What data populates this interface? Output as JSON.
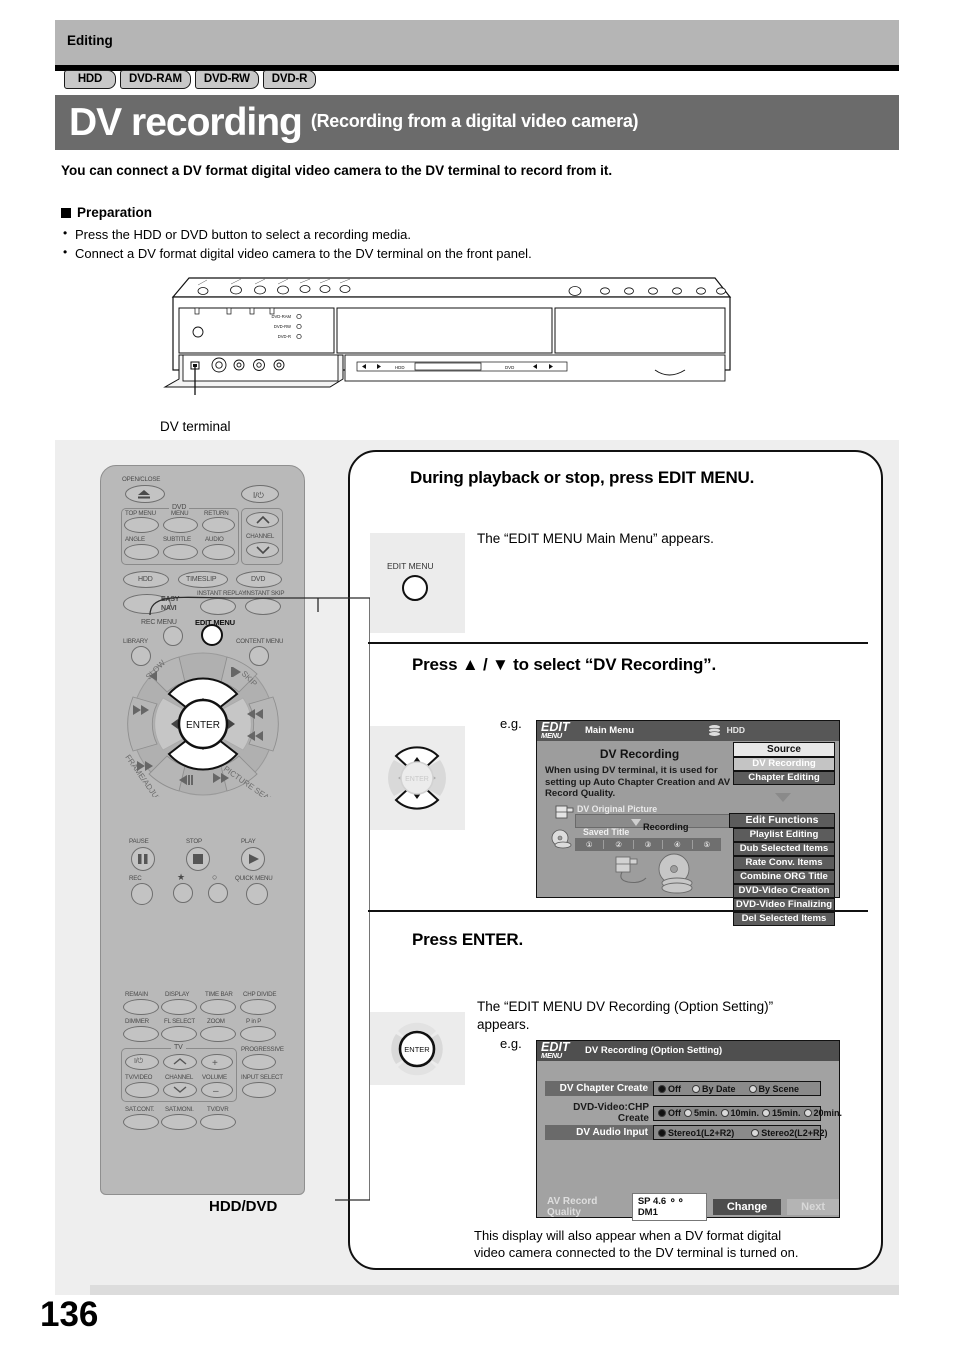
{
  "header": {
    "section_label": "Editing",
    "badges": [
      "HDD",
      "DVD-RAM",
      "DVD-RW",
      "DVD-R"
    ],
    "title_main": "DV recording",
    "title_sub": "(Recording from a digital video camera)"
  },
  "intro": {
    "lead": "You can connect a DV format digital video camera to the DV terminal to record from it.",
    "prep_heading": "Preparation",
    "prep_items": [
      "Press the HDD or DVD button to select a recording media.",
      "Connect a DV format digital video camera to the DV terminal on the front panel."
    ]
  },
  "device": {
    "callout": "DV terminal",
    "disc_lamps": [
      "DVD-RAM",
      "DVD-RW",
      "DVD-R"
    ],
    "front_labels": [
      "HDD",
      "DVD"
    ]
  },
  "remote": {
    "caption": "HDD/DVD",
    "labels": {
      "open_close": "OPEN/CLOSE",
      "power": "power-icon",
      "dvd_group": "DVD",
      "top_menu": "TOP MENU",
      "menu": "MENU",
      "return": "RETURN",
      "angle": "ANGLE",
      "subtitle": "SUBTITLE",
      "audio": "AUDIO",
      "channel": "CHANNEL",
      "hdd": "HDD",
      "timeslip": "TIMESLIP",
      "dvd": "DVD",
      "easy_navi": "EASY NAVI",
      "instant_replay": "INSTANT REPLAY",
      "instant_skip": "INSTANT SKIP",
      "rec_menu": "REC MENU",
      "edit_menu": "EDIT MENU",
      "library": "LIBRARY",
      "content_menu": "CONTENT MENU",
      "slow": "SLOW",
      "skip": "SKIP",
      "frame_adjust": "FRAME/ADJUST",
      "picture_search": "PICTURE SEARCH",
      "enter": "ENTER",
      "pause": "PAUSE",
      "stop": "STOP",
      "play": "PLAY",
      "rec": "REC",
      "quick_menu": "QUICK MENU",
      "remain": "REMAIN",
      "display": "DISPLAY",
      "time_bar": "TIME BAR",
      "chp_divide": "CHP DIVIDE",
      "dimmer": "DIMMER",
      "fl_select": "FL SELECT",
      "zoom": "ZOOM",
      "p_in_p": "P in P",
      "tv_group": "TV",
      "progressive": "PROGRESSIVE",
      "tv_video": "TV/VIDEO",
      "tv_channel": "CHANNEL",
      "volume": "VOLUME",
      "input_select": "INPUT SELECT",
      "sat_cont": "SAT.CONT.",
      "sat_moni": "SAT.MONI.",
      "tv_dvr": "TV/DVR"
    }
  },
  "steps": [
    {
      "title": "During playback or stop, press EDIT MENU.",
      "body": "The “EDIT MENU Main Menu” appears.",
      "key_label": "EDIT MENU",
      "eg": "e.g."
    },
    {
      "title": "Press ▲ / ▼ to select “DV Recording”.",
      "eg": "e.g."
    },
    {
      "title": "Press ENTER.",
      "body_line1": "The “EDIT MENU DV Recording (Option Setting)”",
      "body_line2": "appears.",
      "key_label": "ENTER",
      "eg": "e.g."
    }
  ],
  "osd_main": {
    "logo": "EDIT",
    "logo_sub": "MENU",
    "title": "Main Menu",
    "media": "HDD",
    "heading": "DV Recording",
    "description": "When using DV terminal, it is used for setting up Auto Chapter Creation and AV Record Quality.",
    "original_picture_label": "DV Original Picture",
    "saved_title_label": "Saved Title",
    "recording_label": "Recording",
    "chapters": [
      "①",
      "②",
      "③",
      "④",
      "⑤"
    ],
    "source_header": "Source",
    "source_items": [
      "DV Recording",
      "Chapter Editing"
    ],
    "source_selected": "DV Recording",
    "edit_functions_header": "Edit Functions",
    "edit_functions": [
      "Playlist Editing",
      "Dub Selected Items",
      "Rate Conv. Items",
      "Combine ORG Title",
      "DVD-Video Creation",
      "DVD-Video Finalizing",
      "Del Selected Items"
    ]
  },
  "osd_option": {
    "logo": "EDIT",
    "logo_sub": "MENU",
    "title": "DV Recording (Option Setting)",
    "rows": [
      {
        "label": "DV Chapter Create",
        "options": [
          "Off",
          "By Date",
          "By Scene"
        ],
        "selected": "Off"
      },
      {
        "label": "DVD-Video:CHP Create",
        "options": [
          "Off",
          "5min.",
          "10min.",
          "15min.",
          "20min."
        ],
        "selected": "Off"
      },
      {
        "label": "DV Audio Input",
        "options": [
          "Stereo1(L2+R2)",
          "Stereo2(L2+R2)"
        ],
        "selected": "Stereo1(L2+R2)"
      }
    ],
    "av_quality_label": "AV Record Quality",
    "av_quality_value": "SP 4.6 ⚬⚬ DM1",
    "change_button": "Change",
    "next_button": "Next"
  },
  "final_note": {
    "line1": "This display will also appear when a DV format digital",
    "line2": "video camera connected to the DV terminal is turned on."
  },
  "footer": {
    "page_number": "136"
  },
  "colors": {
    "header_band": "#b5b5b5",
    "title_bar": "#6b6b6b",
    "panel": "#eeeeee",
    "remote_body": "#b9b9b9",
    "osd_bg": "#9d9d9d"
  }
}
